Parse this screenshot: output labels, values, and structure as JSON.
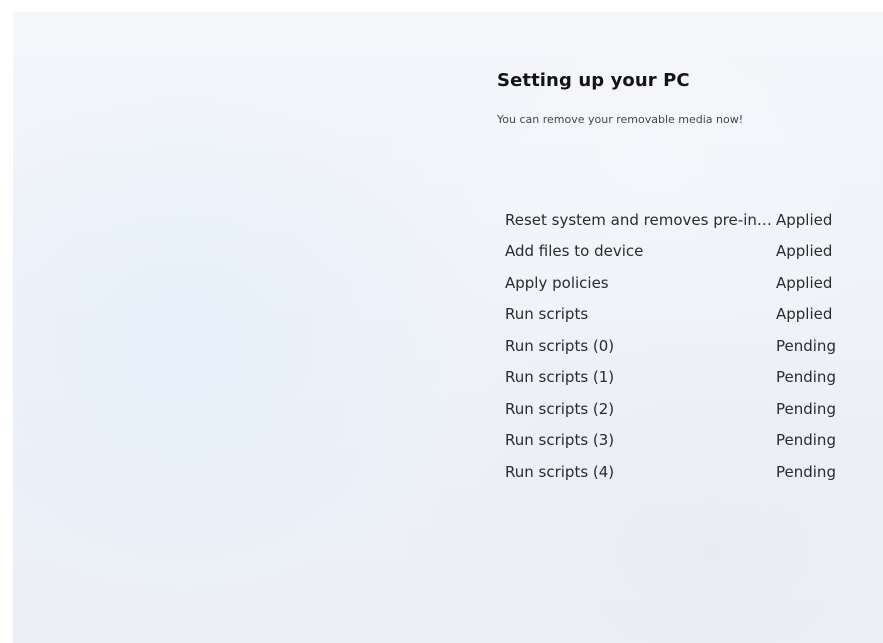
{
  "setup": {
    "title": "Setting up your PC",
    "subtitle": "You can remove your removable media now!"
  },
  "tasks": [
    {
      "name": "Reset system and removes pre-installed apps",
      "status": "Applied"
    },
    {
      "name": "Add files to device",
      "status": "Applied"
    },
    {
      "name": "Apply policies",
      "status": "Applied"
    },
    {
      "name": "Run scripts",
      "status": "Applied"
    },
    {
      "name": "Run scripts (0)",
      "status": "Pending"
    },
    {
      "name": "Run scripts (1)",
      "status": "Pending"
    },
    {
      "name": "Run scripts (2)",
      "status": "Pending"
    },
    {
      "name": "Run scripts (3)",
      "status": "Pending"
    },
    {
      "name": "Run scripts (4)",
      "status": "Pending"
    }
  ]
}
